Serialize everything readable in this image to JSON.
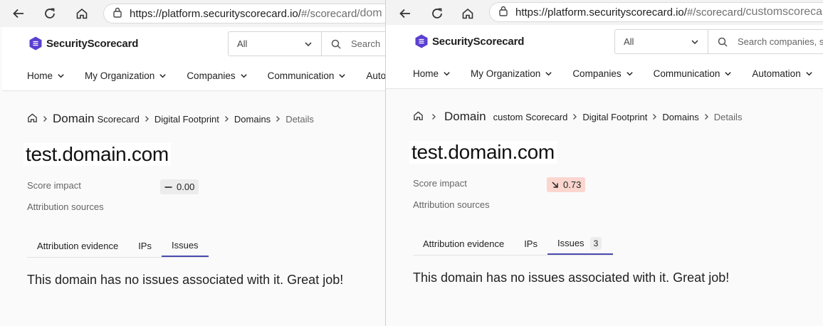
{
  "panes": [
    {
      "browser": {
        "url_host": "https://platform.securityscorecard.io/",
        "url_hash": "#/scorecard/",
        "url_tail": "dom"
      },
      "header": {
        "logo_text": "SecurityScorecard",
        "scope_value": "All",
        "search_placeholder": "Search"
      },
      "menu": [
        "Home",
        "My Organization",
        "Companies",
        "Communication",
        "Auto"
      ],
      "breadcrumb": {
        "domain": "Domain",
        "scorecard": "Scorecard",
        "footprint": "Digital Footprint",
        "domains": "Domains",
        "details": "Details"
      },
      "title": "test.domain.com",
      "fields": {
        "score_impact_label": "Score impact",
        "score_value": "0.00",
        "attribution_label": "Attribution sources"
      },
      "tabs": {
        "evidence": "Attribution evidence",
        "ips": "IPs",
        "issues": "Issues",
        "issues_count": ""
      },
      "empty_message": "This domain has no issues associated with it. Great job!"
    },
    {
      "browser": {
        "url_host": "https://platform.securityscorecard.io/",
        "url_hash": "#/scorecard/",
        "url_tail": "customscoreca"
      },
      "header": {
        "logo_text": "SecurityScorecard",
        "scope_value": "All",
        "search_placeholder": "Search companies, s"
      },
      "menu": [
        "Home",
        "My Organization",
        "Companies",
        "Communication",
        "Automation"
      ],
      "breadcrumb": {
        "domain": "Domain",
        "scorecard": "custom Scorecard",
        "footprint": "Digital Footprint",
        "domains": "Domains",
        "details": "Details"
      },
      "title": "test.domain.com",
      "fields": {
        "score_impact_label": "Score impact",
        "score_value": "0.73",
        "attribution_label": "Attribution sources"
      },
      "tabs": {
        "evidence": "Attribution evidence",
        "ips": "IPs",
        "issues": "Issues",
        "issues_count": "3"
      },
      "empty_message": "This domain has no issues associated with it. Great job!"
    }
  ],
  "icons": {
    "back": "arrow-left-icon",
    "reload": "reload-icon",
    "home": "home-icon",
    "lock": "lock-icon",
    "logo": "hexagon-logo-icon",
    "dropdown": "chevron-down-icon",
    "search": "search-icon",
    "breadcrumb_home": "home-icon",
    "separator": "chevron-right-icon",
    "score_neutral": "dash-icon",
    "score_down": "arrow-down-right-icon"
  },
  "colors": {
    "brand": "#5b3fd1",
    "tab_underline": "#4a4ab0",
    "score_bad_bg": "#fbd6cf",
    "score_neutral_bg": "#ececec",
    "page_bg": "#fafafa"
  }
}
